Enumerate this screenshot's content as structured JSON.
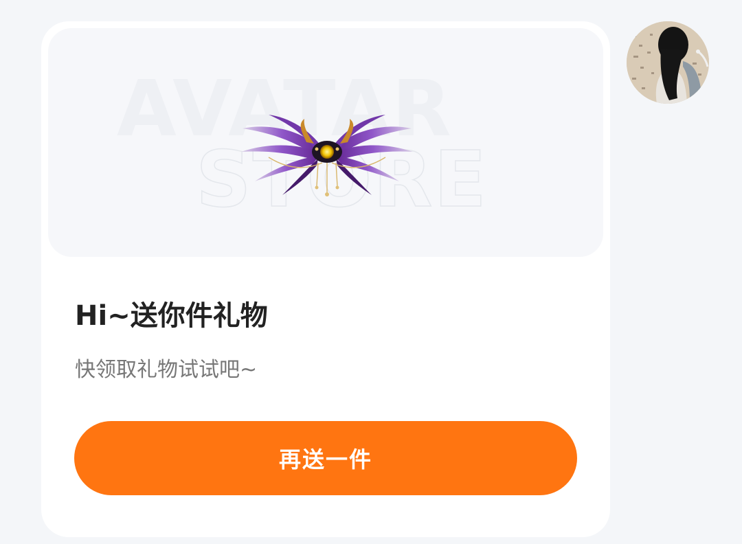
{
  "gift_card": {
    "banner_watermark_top": "AVATAR",
    "banner_watermark_bottom": "STORE",
    "gift_item_icon": "wings-icon",
    "title": "Hi~送你件礼物",
    "subtitle": "快领取礼物试试吧~",
    "cta_label": "再送一件"
  },
  "sender": {
    "avatar_icon": "user-avatar"
  },
  "colors": {
    "page_background": "#f4f6f9",
    "card_background": "#ffffff",
    "banner_background": "#f6f7fa",
    "accent": "#ff7511",
    "title_text": "#222222",
    "subtitle_text": "#777777"
  }
}
